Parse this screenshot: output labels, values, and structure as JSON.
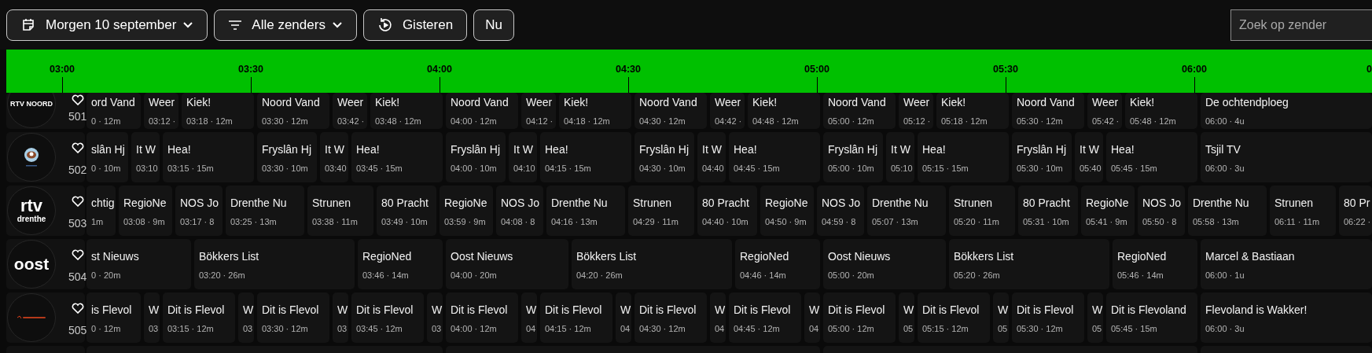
{
  "toolbar": {
    "buttons": [
      {
        "kind": "date",
        "label": "Morgen 10 september",
        "dropdown": true
      },
      {
        "kind": "filter",
        "label": "Alle zenders",
        "dropdown": true
      },
      {
        "kind": "replay",
        "label": "Gisteren",
        "dropdown": false
      },
      {
        "kind": "plain",
        "label": "Nu",
        "dropdown": false
      }
    ],
    "search": {
      "placeholder": "Zoek op zender"
    }
  },
  "timeline": {
    "ticks": [
      "03:00",
      "03:30",
      "04:00",
      "04:30",
      "05:00",
      "05:30",
      "06:00",
      "0"
    ]
  },
  "channels": [
    {
      "number": "501",
      "logo": {
        "kind": "caption",
        "lines": [
          "RTV NOORD"
        ]
      },
      "favorite": false,
      "programs": [
        {
          "title": "ord Vand",
          "time": "0 · 12m"
        },
        {
          "title": "Weer",
          "time": "03:12 ·"
        },
        {
          "title": "Kiek!",
          "time": "03:18 · 12m"
        },
        {
          "title": "Noord Vand",
          "time": "03:30 · 12m"
        },
        {
          "title": "Weer",
          "time": "03:42 ·"
        },
        {
          "title": "Kiek!",
          "time": "03:48 · 12m"
        },
        {
          "title": "Noord Vand",
          "time": "04:00 · 12m"
        },
        {
          "title": "Weer",
          "time": "04:12 ·"
        },
        {
          "title": "Kiek!",
          "time": "04:18 · 12m"
        },
        {
          "title": "Noord Vand",
          "time": "04:30 · 12m"
        },
        {
          "title": "Weer",
          "time": "04:42 ·"
        },
        {
          "title": "Kiek!",
          "time": "04:48 · 12m"
        },
        {
          "title": "Noord Vand",
          "time": "05:00 · 12m"
        },
        {
          "title": "Weer",
          "time": "05:12 ·"
        },
        {
          "title": "Kiek!",
          "time": "05:18 · 12m"
        },
        {
          "title": "Noord Vand",
          "time": "05:30 · 12m"
        },
        {
          "title": "Weer",
          "time": "05:42 ·"
        },
        {
          "title": "Kiek!",
          "time": "05:48 · 12m"
        },
        {
          "title": "De ochtendploeg",
          "time": "06:00 · 4u"
        }
      ]
    },
    {
      "number": "502",
      "logo": {
        "kind": "eye"
      },
      "favorite": false,
      "programs": [
        {
          "title": "slân Hj",
          "time": "0 · 10m"
        },
        {
          "title": "It W",
          "time": "03:10"
        },
        {
          "title": "Hea!",
          "time": "03:15 · 15m"
        },
        {
          "title": "Fryslân Hj",
          "time": "03:30 · 10m"
        },
        {
          "title": "It W",
          "time": "03:40"
        },
        {
          "title": "Hea!",
          "time": "03:45 · 15m"
        },
        {
          "title": "Fryslân Hj",
          "time": "04:00 · 10m"
        },
        {
          "title": "It W",
          "time": "04:10"
        },
        {
          "title": "Hea!",
          "time": "04:15 · 15m"
        },
        {
          "title": "Fryslân Hj",
          "time": "04:30 · 10m"
        },
        {
          "title": "It W",
          "time": "04:40"
        },
        {
          "title": "Hea!",
          "time": "04:45 · 15m"
        },
        {
          "title": "Fryslân Hj",
          "time": "05:00 · 10m"
        },
        {
          "title": "It W",
          "time": "05:10"
        },
        {
          "title": "Hea!",
          "time": "05:15 · 15m"
        },
        {
          "title": "Fryslân Hj",
          "time": "05:30 · 10m"
        },
        {
          "title": "It W",
          "time": "05:40"
        },
        {
          "title": "Hea!",
          "time": "05:45 · 15m"
        },
        {
          "title": "Tsjil TV",
          "time": "06:00 · 3u"
        }
      ]
    },
    {
      "number": "503",
      "logo": {
        "kind": "stacked",
        "lines": [
          "rtv",
          "drenthe"
        ]
      },
      "favorite": false,
      "programs": [
        {
          "title": "chtig",
          "time": "1m"
        },
        {
          "title": "RegioNe",
          "time": "03:08 · 9m"
        },
        {
          "title": "NOS Jo",
          "time": "03:17 · 8"
        },
        {
          "title": "Drenthe Nu",
          "time": "03:25 · 13m"
        },
        {
          "title": "Strunen",
          "time": "03:38 · 11m"
        },
        {
          "title": "80 Pracht",
          "time": "03:49 · 10m"
        },
        {
          "title": "RegioNe",
          "time": "03:59 · 9m"
        },
        {
          "title": "NOS Jo",
          "time": "04:08 · 8"
        },
        {
          "title": "Drenthe Nu",
          "time": "04:16 · 13m"
        },
        {
          "title": "Strunen",
          "time": "04:29 · 11m"
        },
        {
          "title": "80 Pracht",
          "time": "04:40 · 10m"
        },
        {
          "title": "RegioNe",
          "time": "04:50 · 9m"
        },
        {
          "title": "NOS Jo",
          "time": "04:59 · 8"
        },
        {
          "title": "Drenthe Nu",
          "time": "05:07 · 13m"
        },
        {
          "title": "Strunen",
          "time": "05:20 · 11m"
        },
        {
          "title": "80 Pracht",
          "time": "05:31 · 10m"
        },
        {
          "title": "RegioNe",
          "time": "05:41 · 9m"
        },
        {
          "title": "NOS Jo",
          "time": "05:50 · 8"
        },
        {
          "title": "Drenthe Nu",
          "time": "05:58 · 13m"
        },
        {
          "title": "Strunen",
          "time": "06:11 · 11m"
        },
        {
          "title": "80 Pr",
          "time": "06:22 ·"
        }
      ]
    },
    {
      "number": "504",
      "logo": {
        "kind": "wordmark",
        "lines": [
          "oost"
        ]
      },
      "favorite": false,
      "programs": [
        {
          "title": "st Nieuws",
          "time": "0 · 20m"
        },
        {
          "title": "Bökkers List",
          "time": "03:20 · 26m"
        },
        {
          "title": "RegioNed",
          "time": "03:46 · 14m"
        },
        {
          "title": "Oost Nieuws",
          "time": "04:00 · 20m"
        },
        {
          "title": "Bökkers List",
          "time": "04:20 · 26m"
        },
        {
          "title": "RegioNed",
          "time": "04:46 · 14m"
        },
        {
          "title": "Oost Nieuws",
          "time": "05:00 · 20m"
        },
        {
          "title": "Bökkers List",
          "time": "05:20 · 26m"
        },
        {
          "title": "RegioNed",
          "time": "05:46 · 14m"
        },
        {
          "title": "Marcel & Bastiaan",
          "time": "06:00 · 1u"
        }
      ]
    },
    {
      "number": "505",
      "logo": {
        "kind": "wave"
      },
      "favorite": false,
      "programs": [
        {
          "title": "is Flevol",
          "time": "0 · 12m"
        },
        {
          "title": "W",
          "time": "03"
        },
        {
          "title": "Dit is Flevol",
          "time": "03:15 · 12m"
        },
        {
          "title": "W",
          "time": "03"
        },
        {
          "title": "Dit is Flevol",
          "time": "03:30 · 12m"
        },
        {
          "title": "W",
          "time": "03"
        },
        {
          "title": "Dit is Flevol",
          "time": "03:45 · 12m"
        },
        {
          "title": "W",
          "time": "03"
        },
        {
          "title": "Dit is Flevol",
          "time": "04:00 · 12m"
        },
        {
          "title": "W",
          "time": "04"
        },
        {
          "title": "Dit is Flevol",
          "time": "04:15 · 12m"
        },
        {
          "title": "W",
          "time": "04"
        },
        {
          "title": "Dit is Flevol",
          "time": "04:30 · 12m"
        },
        {
          "title": "W",
          "time": "04"
        },
        {
          "title": "Dit is Flevol",
          "time": "04:45 · 12m"
        },
        {
          "title": "W",
          "time": "04"
        },
        {
          "title": "Dit is Flevol",
          "time": "05:00 · 12m"
        },
        {
          "title": "W",
          "time": "05"
        },
        {
          "title": "Dit is Flevol",
          "time": "05:15 · 12m"
        },
        {
          "title": "W",
          "time": "05"
        },
        {
          "title": "Dit is Flevol",
          "time": "05:30 · 12m"
        },
        {
          "title": "W",
          "time": "05"
        },
        {
          "title": "Dit is Flevoland",
          "time": "05:45 · 15m"
        },
        {
          "title": "Flevoland is Wakker!",
          "time": "06:00 · 3u"
        }
      ]
    }
  ]
}
